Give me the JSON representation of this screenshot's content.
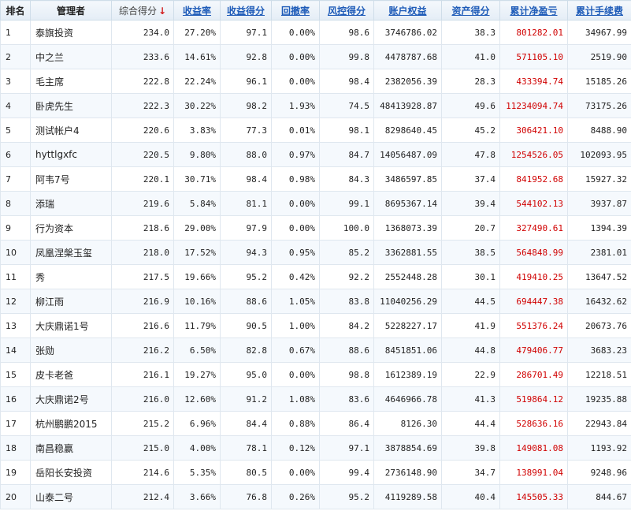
{
  "headers": {
    "rank": "排名",
    "manager": "管理者",
    "overall_score": "综合得分",
    "sort_indicator": "↓",
    "return_rate": "收益率",
    "return_score": "收益得分",
    "drawdown": "回撤率",
    "risk_score": "风控得分",
    "account_equity": "账户权益",
    "asset_score": "资产得分",
    "net_profit": "累计净盈亏",
    "fees": "累计手续费"
  },
  "colors": {
    "header_link": "#1e5bb8",
    "sort_arrow": "#d21c1c",
    "profit_red": "#d00000",
    "row_alt": "#f5f9fd"
  },
  "rows": [
    {
      "rank": "1",
      "manager": "泰旗投资",
      "overall_score": "234.0",
      "return_rate": "27.20%",
      "return_score": "97.1",
      "drawdown": "0.00%",
      "risk_score": "98.6",
      "account_equity": "3746786.02",
      "asset_score": "38.3",
      "net_profit": "801282.01",
      "fees": "34967.99"
    },
    {
      "rank": "2",
      "manager": "中之兰",
      "overall_score": "233.6",
      "return_rate": "14.61%",
      "return_score": "92.8",
      "drawdown": "0.00%",
      "risk_score": "99.8",
      "account_equity": "4478787.68",
      "asset_score": "41.0",
      "net_profit": "571105.10",
      "fees": "2519.90"
    },
    {
      "rank": "3",
      "manager": "毛主席",
      "overall_score": "222.8",
      "return_rate": "22.24%",
      "return_score": "96.1",
      "drawdown": "0.00%",
      "risk_score": "98.4",
      "account_equity": "2382056.39",
      "asset_score": "28.3",
      "net_profit": "433394.74",
      "fees": "15185.26"
    },
    {
      "rank": "4",
      "manager": "卧虎先生",
      "overall_score": "222.3",
      "return_rate": "30.22%",
      "return_score": "98.2",
      "drawdown": "1.93%",
      "risk_score": "74.5",
      "account_equity": "48413928.87",
      "asset_score": "49.6",
      "net_profit": "11234094.74",
      "fees": "73175.26"
    },
    {
      "rank": "5",
      "manager": "测试帐户4",
      "overall_score": "220.6",
      "return_rate": "3.83%",
      "return_score": "77.3",
      "drawdown": "0.01%",
      "risk_score": "98.1",
      "account_equity": "8298640.45",
      "asset_score": "45.2",
      "net_profit": "306421.10",
      "fees": "8488.90"
    },
    {
      "rank": "6",
      "manager": "hyttlgxfc",
      "overall_score": "220.5",
      "return_rate": "9.80%",
      "return_score": "88.0",
      "drawdown": "0.97%",
      "risk_score": "84.7",
      "account_equity": "14056487.09",
      "asset_score": "47.8",
      "net_profit": "1254526.05",
      "fees": "102093.95"
    },
    {
      "rank": "7",
      "manager": "阿韦7号",
      "overall_score": "220.1",
      "return_rate": "30.71%",
      "return_score": "98.4",
      "drawdown": "0.98%",
      "risk_score": "84.3",
      "account_equity": "3486597.85",
      "asset_score": "37.4",
      "net_profit": "841952.68",
      "fees": "15927.32"
    },
    {
      "rank": "8",
      "manager": "添瑞",
      "overall_score": "219.6",
      "return_rate": "5.84%",
      "return_score": "81.1",
      "drawdown": "0.00%",
      "risk_score": "99.1",
      "account_equity": "8695367.14",
      "asset_score": "39.4",
      "net_profit": "544102.13",
      "fees": "3937.87"
    },
    {
      "rank": "9",
      "manager": "行为资本",
      "overall_score": "218.6",
      "return_rate": "29.00%",
      "return_score": "97.9",
      "drawdown": "0.00%",
      "risk_score": "100.0",
      "account_equity": "1368073.39",
      "asset_score": "20.7",
      "net_profit": "327490.61",
      "fees": "1394.39"
    },
    {
      "rank": "10",
      "manager": "凤凰涅槃玉玺",
      "overall_score": "218.0",
      "return_rate": "17.52%",
      "return_score": "94.3",
      "drawdown": "0.95%",
      "risk_score": "85.2",
      "account_equity": "3362881.55",
      "asset_score": "38.5",
      "net_profit": "564848.99",
      "fees": "2381.01"
    },
    {
      "rank": "11",
      "manager": "秀",
      "overall_score": "217.5",
      "return_rate": "19.66%",
      "return_score": "95.2",
      "drawdown": "0.42%",
      "risk_score": "92.2",
      "account_equity": "2552448.28",
      "asset_score": "30.1",
      "net_profit": "419410.25",
      "fees": "13647.52"
    },
    {
      "rank": "12",
      "manager": "柳江雨",
      "overall_score": "216.9",
      "return_rate": "10.16%",
      "return_score": "88.6",
      "drawdown": "1.05%",
      "risk_score": "83.8",
      "account_equity": "11040256.29",
      "asset_score": "44.5",
      "net_profit": "694447.38",
      "fees": "16432.62"
    },
    {
      "rank": "13",
      "manager": "大庆鼎诺1号",
      "overall_score": "216.6",
      "return_rate": "11.79%",
      "return_score": "90.5",
      "drawdown": "1.00%",
      "risk_score": "84.2",
      "account_equity": "5228227.17",
      "asset_score": "41.9",
      "net_profit": "551376.24",
      "fees": "20673.76"
    },
    {
      "rank": "14",
      "manager": "张勋",
      "overall_score": "216.2",
      "return_rate": "6.50%",
      "return_score": "82.8",
      "drawdown": "0.67%",
      "risk_score": "88.6",
      "account_equity": "8451851.06",
      "asset_score": "44.8",
      "net_profit": "479406.77",
      "fees": "3683.23"
    },
    {
      "rank": "15",
      "manager": "皮卡老爸",
      "overall_score": "216.1",
      "return_rate": "19.27%",
      "return_score": "95.0",
      "drawdown": "0.00%",
      "risk_score": "98.8",
      "account_equity": "1612389.19",
      "asset_score": "22.9",
      "net_profit": "286701.49",
      "fees": "12218.51"
    },
    {
      "rank": "16",
      "manager": "大庆鼎诺2号",
      "overall_score": "216.0",
      "return_rate": "12.60%",
      "return_score": "91.2",
      "drawdown": "1.08%",
      "risk_score": "83.6",
      "account_equity": "4646966.78",
      "asset_score": "41.3",
      "net_profit": "519864.12",
      "fees": "19235.88"
    },
    {
      "rank": "17",
      "manager": "杭州鹏鹏2015",
      "overall_score": "215.2",
      "return_rate": "6.96%",
      "return_score": "84.4",
      "drawdown": "0.88%",
      "risk_score": "86.4",
      "account_equity": "8126.30",
      "asset_score": "44.4",
      "net_profit": "528636.16",
      "fees": "22943.84"
    },
    {
      "rank": "18",
      "manager": "南昌稳赢",
      "overall_score": "215.0",
      "return_rate": "4.00%",
      "return_score": "78.1",
      "drawdown": "0.12%",
      "risk_score": "97.1",
      "account_equity": "3878854.69",
      "asset_score": "39.8",
      "net_profit": "149081.08",
      "fees": "1193.92"
    },
    {
      "rank": "19",
      "manager": "岳阳长安投资",
      "overall_score": "214.6",
      "return_rate": "5.35%",
      "return_score": "80.5",
      "drawdown": "0.00%",
      "risk_score": "99.4",
      "account_equity": "2736148.90",
      "asset_score": "34.7",
      "net_profit": "138991.04",
      "fees": "9248.96"
    },
    {
      "rank": "20",
      "manager": "山泰二号",
      "overall_score": "212.4",
      "return_rate": "3.66%",
      "return_score": "76.8",
      "drawdown": "0.26%",
      "risk_score": "95.2",
      "account_equity": "4119289.58",
      "asset_score": "40.4",
      "net_profit": "145505.33",
      "fees": "844.67"
    }
  ]
}
